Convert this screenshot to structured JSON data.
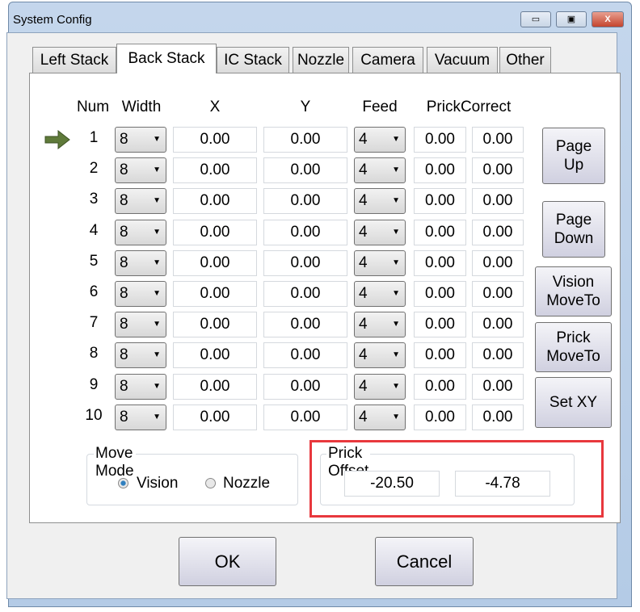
{
  "window": {
    "title": "System Config",
    "minimize": "▭",
    "maximize": "▣",
    "close": "X"
  },
  "tabs": [
    {
      "label": "Left Stack"
    },
    {
      "label": "Back Stack",
      "active": true
    },
    {
      "label": "IC Stack"
    },
    {
      "label": "Nozzle"
    },
    {
      "label": "Camera"
    },
    {
      "label": "Vacuum"
    },
    {
      "label": "Other"
    }
  ],
  "headers": {
    "num": "Num",
    "width": "Width",
    "x": "X",
    "y": "Y",
    "feed": "Feed",
    "prick": "PrickCorrect"
  },
  "current_row": 1,
  "rows": [
    {
      "num": "1",
      "width": "8",
      "x": "0.00",
      "y": "0.00",
      "feed": "4",
      "p1": "0.00",
      "p2": "0.00"
    },
    {
      "num": "2",
      "width": "8",
      "x": "0.00",
      "y": "0.00",
      "feed": "4",
      "p1": "0.00",
      "p2": "0.00"
    },
    {
      "num": "3",
      "width": "8",
      "x": "0.00",
      "y": "0.00",
      "feed": "4",
      "p1": "0.00",
      "p2": "0.00"
    },
    {
      "num": "4",
      "width": "8",
      "x": "0.00",
      "y": "0.00",
      "feed": "4",
      "p1": "0.00",
      "p2": "0.00"
    },
    {
      "num": "5",
      "width": "8",
      "x": "0.00",
      "y": "0.00",
      "feed": "4",
      "p1": "0.00",
      "p2": "0.00"
    },
    {
      "num": "6",
      "width": "8",
      "x": "0.00",
      "y": "0.00",
      "feed": "4",
      "p1": "0.00",
      "p2": "0.00"
    },
    {
      "num": "7",
      "width": "8",
      "x": "0.00",
      "y": "0.00",
      "feed": "4",
      "p1": "0.00",
      "p2": "0.00"
    },
    {
      "num": "8",
      "width": "8",
      "x": "0.00",
      "y": "0.00",
      "feed": "4",
      "p1": "0.00",
      "p2": "0.00"
    },
    {
      "num": "9",
      "width": "8",
      "x": "0.00",
      "y": "0.00",
      "feed": "4",
      "p1": "0.00",
      "p2": "0.00"
    },
    {
      "num": "10",
      "width": "8",
      "x": "0.00",
      "y": "0.00",
      "feed": "4",
      "p1": "0.00",
      "p2": "0.00"
    }
  ],
  "side_buttons": {
    "page_up": [
      "Page",
      "Up"
    ],
    "page_down": [
      "Page",
      "Down"
    ],
    "vision_moveto": [
      "Vision",
      "MoveTo"
    ],
    "prick_moveto": [
      "Prick",
      "MoveTo"
    ],
    "set_xy": "Set XY"
  },
  "move_mode": {
    "label": "Move Mode",
    "options": [
      "Vision",
      "Nozzle"
    ],
    "selected": "Vision"
  },
  "prick_offset": {
    "label": "Prick Offset",
    "x": "-20.50",
    "y": "-4.78",
    "highlight_color": "#e8383d"
  },
  "footer": {
    "ok": "OK",
    "cancel": "Cancel"
  }
}
